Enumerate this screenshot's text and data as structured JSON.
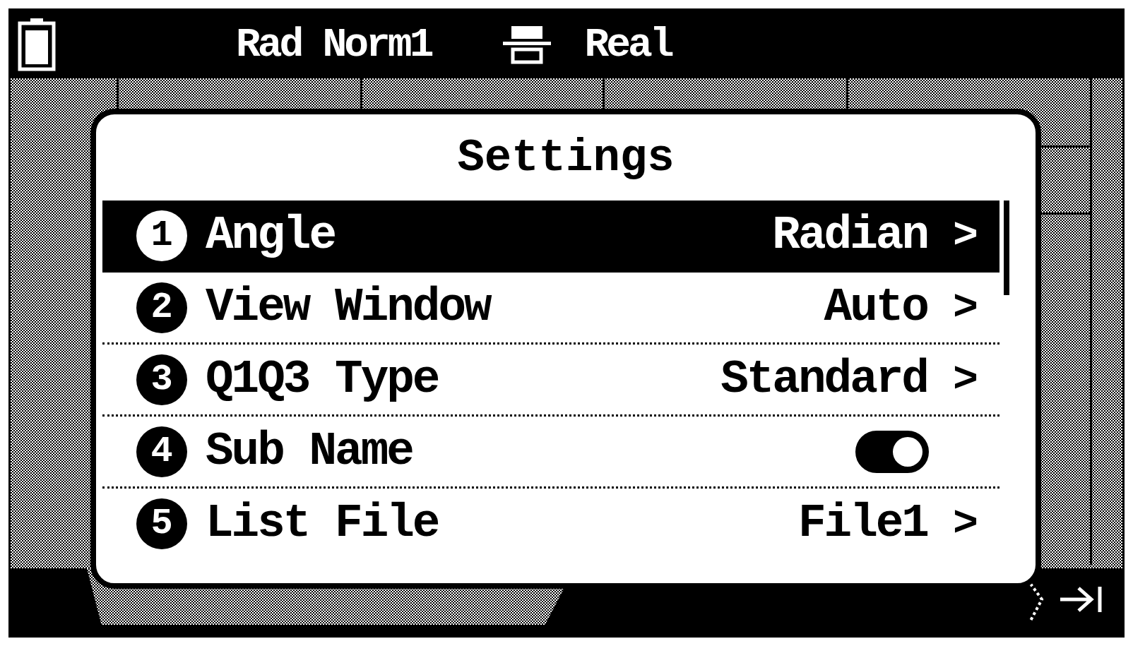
{
  "status_bar": {
    "angle_mode": "Rad",
    "display_mode": "Norm1",
    "complex_mode": "Real"
  },
  "dialog": {
    "title": "Settings",
    "items": [
      {
        "number": "1",
        "label": "Angle",
        "kind": "choice",
        "value": "Radian",
        "chevron": ">",
        "selected": true
      },
      {
        "number": "2",
        "label": "View Window",
        "kind": "choice",
        "value": "Auto",
        "chevron": ">",
        "selected": false
      },
      {
        "number": "3",
        "label": "Q1Q3 Type",
        "kind": "choice",
        "value": "Standard",
        "chevron": ">",
        "selected": false
      },
      {
        "number": "4",
        "label": "Sub Name",
        "kind": "toggle",
        "on": true,
        "selected": false
      },
      {
        "number": "5",
        "label": "List File",
        "kind": "choice",
        "value": "File1",
        "chevron": ">",
        "selected": false
      }
    ]
  }
}
